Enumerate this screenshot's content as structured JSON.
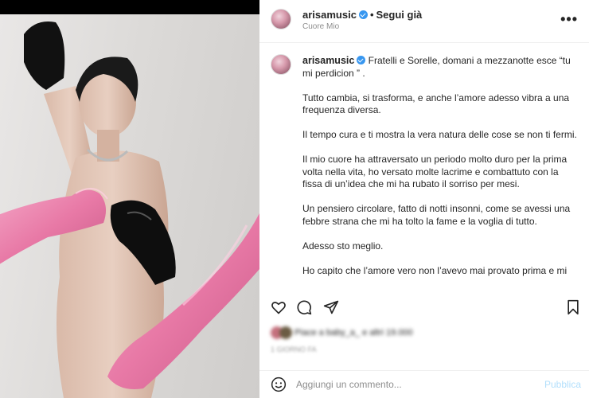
{
  "header": {
    "username": "arisamusic",
    "separator": "•",
    "follow_label": "Segui già",
    "subtitle": "Cuore Mio",
    "more_icon": "more-options-icon"
  },
  "caption": {
    "username": "arisamusic",
    "paragraphs": [
      "Fratelli e Sorelle, domani a mezzanotte esce “tu mi perdicion ” .",
      "Tutto cambia, si trasforma, e anche l’amore adesso vibra a una frequenza diversa.",
      "Il tempo cura e ti mostra la vera natura delle cose se non ti fermi.",
      "Il mio cuore ha attraversato un periodo molto duro per la prima volta nella vita, ho versato molte lacrime e combattuto con la fissa di un’idea che mi ha rubato il sorriso per mesi.",
      "Un pensiero circolare, fatto di notti insonni, come se avessi una febbre strana che mi ha tolto la fame e la voglia di tutto.",
      "Adesso sto meglio.",
      "Ho capito che l’amore vero non l’avevo mai provato prima e mi sono scoperta in grado di dare tanto. Non m’importa dell’esito."
    ]
  },
  "actions": {
    "icons": [
      "heart-icon",
      "comment-icon",
      "share-icon",
      "bookmark-icon"
    ]
  },
  "likes_text": "Piace a baby_a_ e altri 19.000",
  "date_text": "1 GIORNO FA",
  "comment": {
    "placeholder": "Aggiungi un commento...",
    "publish_label": "Pubblica"
  },
  "colors": {
    "verified": "#3897f0",
    "publish_disabled": "#b2dffc",
    "pink_glove": "#e879a6",
    "black_glove": "#111111"
  }
}
